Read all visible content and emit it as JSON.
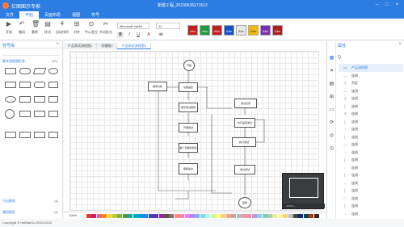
{
  "app": {
    "name": "亿图图示专家",
    "doc_title": "新建工程_20230926171513"
  },
  "menu": {
    "tabs": [
      "文件",
      "开始",
      "页面布局",
      "视图",
      "符号"
    ]
  },
  "toolbar": {
    "tools": [
      {
        "icon": "play-icon",
        "label": "开始"
      },
      {
        "icon": "undo-icon",
        "label": "撤消"
      },
      {
        "icon": "delete-icon",
        "label": "删除"
      },
      {
        "icon": "style-icon",
        "label": "样式"
      },
      {
        "icon": "auto-layout-icon",
        "label": "自动排列"
      },
      {
        "icon": "align-icon",
        "label": "对齐"
      },
      {
        "icon": "position-icon",
        "label": "中心定位"
      },
      {
        "icon": "unlink-icon",
        "label": "节点拆分"
      },
      {
        "icon": "reset-icon",
        "label": "默认样式"
      }
    ],
    "font": "Microsoft YaHei",
    "size": "12",
    "format": [
      "B",
      "I",
      "U",
      "A",
      "ab"
    ],
    "swatch_label": "Abc",
    "swatches": [
      "#c21e1e",
      "#1f9a3c",
      "#c21e1e",
      "#1452c9",
      "#e8e8e8",
      "#f2b705",
      "#7b2fb8",
      "#a62020"
    ]
  },
  "left_panel": {
    "title": "符号库",
    "sections": [
      {
        "label": "基本流程图形状",
        "count": "(25)"
      },
      {
        "label": "引出图线",
        "count": "(6)"
      },
      {
        "label": "通用图形",
        "count": "(9)"
      }
    ]
  },
  "tabs": [
    "产品测试流程图1",
    "仿佛图2",
    "产品测试流程图3"
  ],
  "flow": {
    "start": "开始",
    "end": "结束",
    "nodes": [
      "需求分析",
      "功能是否",
      "编写测试用例",
      "开展测试",
      "各个功能的测试",
      "审核提交",
      "测试记录",
      "执行是否通过",
      "执行测试",
      "通过测试"
    ]
  },
  "minimap": {
    "zoom": "- 100% +"
  },
  "bottom": {
    "zoom": "100%"
  },
  "palette": [
    "#e53935",
    "#d81b60",
    "#f06292",
    "#fb8c00",
    "#fdd835",
    "#c0ca33",
    "#7cb342",
    "#43a047",
    "#26a69a",
    "#00acc1",
    "#039be5",
    "#1e88e5",
    "#3949ab",
    "#5e35b1",
    "#8e24aa",
    "#6d4c41",
    "#757575",
    "#ff8a80",
    "#ff80ab",
    "#ea80fc",
    "#b388ff",
    "#82b1ff",
    "#80d8ff",
    "#a7ffeb",
    "#ccff90",
    "#ffff8d",
    "#ffd180",
    "#ff9e80",
    "#bcaaa4",
    "#b0bec5",
    "#ef9a9a",
    "#f48fb1",
    "#ce93d8",
    "#90caf9",
    "#80cbc4",
    "#a5d6a7",
    "#e6ee9c",
    "#fff59d",
    "#ffcc80",
    "#bdbdbd",
    "#424242",
    "#1a237e",
    "#004d40",
    "#bf360c",
    "#3e2723"
  ],
  "right_panel": {
    "title": "属性",
    "search": "Q",
    "rows": [
      {
        "mark": "▭",
        "label": "产品流程图"
      },
      {
        "mark": "—",
        "label": "连线"
      },
      {
        "mark": "◇",
        "label": "判定"
      },
      {
        "mark": "—",
        "label": "连线"
      },
      {
        "mark": "┼",
        "label": "连线"
      },
      {
        "mark": "│",
        "label": "连线"
      },
      {
        "mark": "┼",
        "label": "连线"
      },
      {
        "mark": "│",
        "label": "连线"
      },
      {
        "mark": "↓",
        "label": "连线"
      },
      {
        "mark": "│",
        "label": "连线"
      },
      {
        "mark": "—",
        "label": "连线"
      },
      {
        "mark": "↑",
        "label": "连线"
      },
      {
        "mark": "│",
        "label": "连线"
      },
      {
        "mark": "↓",
        "label": "连线"
      },
      {
        "mark": "│",
        "label": "连线"
      },
      {
        "mark": "→",
        "label": "连线"
      },
      {
        "mark": "│",
        "label": "连线"
      },
      {
        "mark": "□",
        "label": "连线"
      },
      {
        "mark": "│",
        "label": "连线"
      },
      {
        "mark": "↓",
        "label": "连线"
      }
    ]
  },
  "footer": {
    "copyright": "Copyright © HelBanGo 2019-2022"
  }
}
